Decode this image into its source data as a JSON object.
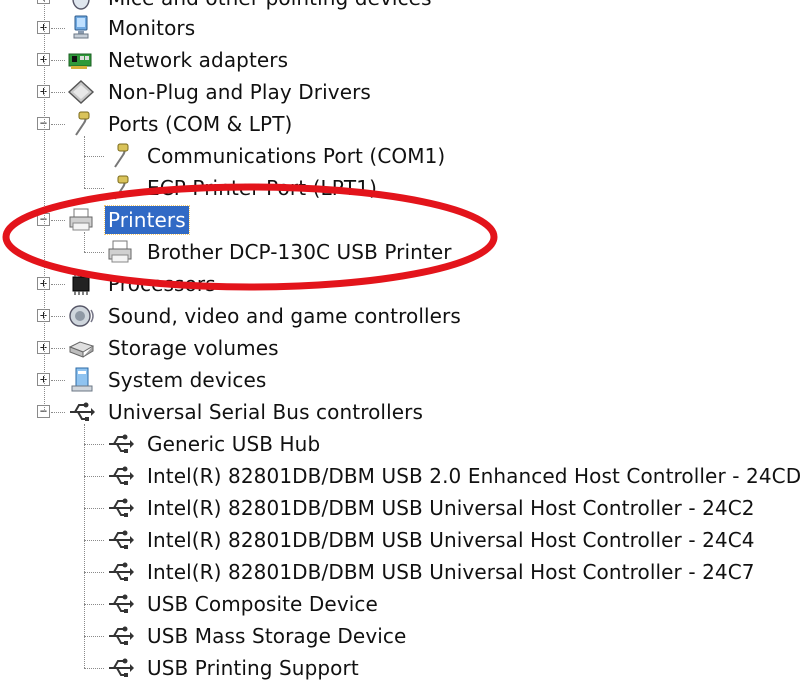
{
  "tree": {
    "top_partial_label": "Mice and other pointing devices",
    "items": [
      {
        "id": "monitors",
        "label": "Monitors",
        "level": 0,
        "expanded": false,
        "icon": "monitor-icon"
      },
      {
        "id": "network",
        "label": "Network adapters",
        "level": 0,
        "expanded": false,
        "icon": "network-adapter-icon"
      },
      {
        "id": "nonpnp",
        "label": "Non-Plug and Play Drivers",
        "level": 0,
        "expanded": false,
        "icon": "non-pnp-driver-icon"
      },
      {
        "id": "ports",
        "label": "Ports (COM & LPT)",
        "level": 0,
        "expanded": true,
        "icon": "port-icon"
      },
      {
        "id": "com1",
        "label": "Communications Port (COM1)",
        "level": 1,
        "icon": "port-icon"
      },
      {
        "id": "lpt1",
        "label": "ECP Printer Port (LPT1)",
        "level": 1,
        "icon": "port-icon"
      },
      {
        "id": "printers",
        "label": "Printers",
        "level": 0,
        "expanded": true,
        "selected": true,
        "icon": "printer-icon"
      },
      {
        "id": "brother",
        "label": "Brother DCP-130C USB Printer",
        "level": 1,
        "icon": "printer-icon"
      },
      {
        "id": "processors",
        "label": "Processors",
        "level": 0,
        "expanded": false,
        "icon": "processor-icon"
      },
      {
        "id": "sound",
        "label": "Sound, video and game controllers",
        "level": 0,
        "expanded": false,
        "icon": "speaker-icon"
      },
      {
        "id": "storage",
        "label": "Storage volumes",
        "level": 0,
        "expanded": false,
        "icon": "storage-volume-icon"
      },
      {
        "id": "system",
        "label": "System devices",
        "level": 0,
        "expanded": false,
        "icon": "system-device-icon"
      },
      {
        "id": "usb",
        "label": "Universal Serial Bus controllers",
        "level": 0,
        "expanded": true,
        "icon": "usb-icon"
      },
      {
        "id": "hub",
        "label": "Generic USB Hub",
        "level": 1,
        "icon": "usb-icon"
      },
      {
        "id": "ehci",
        "label": "Intel(R) 82801DB/DBM USB 2.0 Enhanced Host Controller - 24CD",
        "level": 1,
        "icon": "usb-icon"
      },
      {
        "id": "uhci2",
        "label": "Intel(R) 82801DB/DBM USB Universal Host Controller - 24C2",
        "level": 1,
        "icon": "usb-icon"
      },
      {
        "id": "uhci4",
        "label": "Intel(R) 82801DB/DBM USB Universal Host Controller - 24C4",
        "level": 1,
        "icon": "usb-icon"
      },
      {
        "id": "uhci7",
        "label": "Intel(R) 82801DB/DBM USB Universal Host Controller - 24C7",
        "level": 1,
        "icon": "usb-icon"
      },
      {
        "id": "composite",
        "label": "USB Composite Device",
        "level": 1,
        "icon": "usb-icon"
      },
      {
        "id": "mass",
        "label": "USB Mass Storage Device",
        "level": 1,
        "icon": "usb-icon"
      },
      {
        "id": "printsupport",
        "label": "USB Printing Support",
        "level": 1,
        "icon": "usb-icon"
      }
    ],
    "expand_glyph": "+",
    "collapse_glyph": "−"
  },
  "annotation": {
    "shape": "ellipse",
    "color": "#e3141b",
    "encloses": [
      "printers",
      "brother"
    ]
  },
  "colors": {
    "selection": "#316ac5",
    "selection_text": "#ffffff",
    "tree_lines": "#8a8a8a"
  }
}
